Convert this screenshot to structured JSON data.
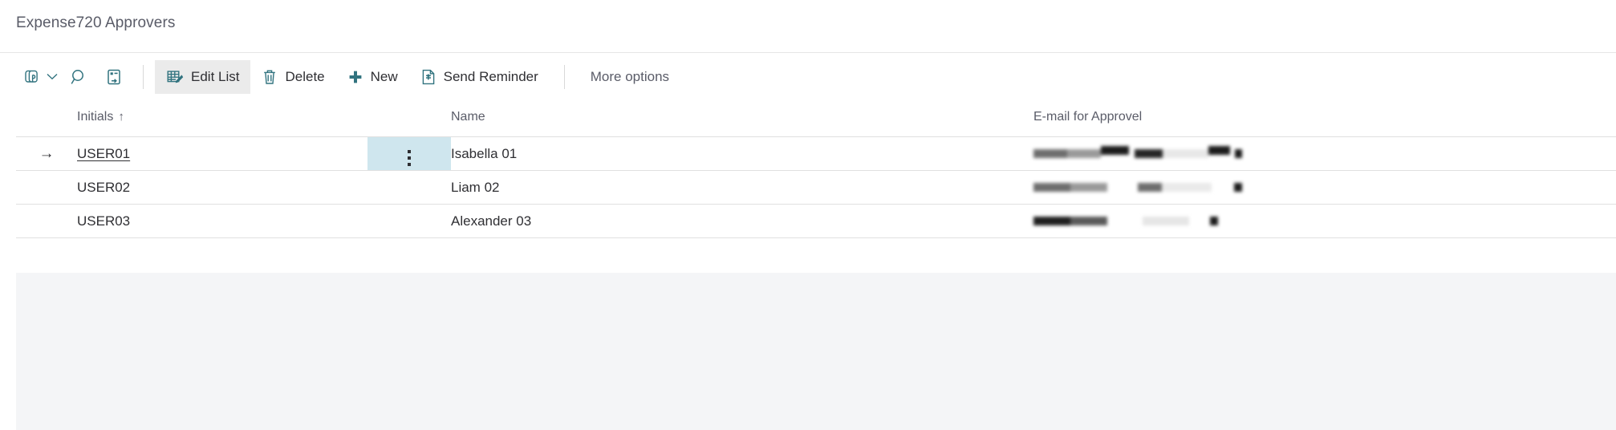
{
  "page": {
    "title": "Expense720 Approvers",
    "accent_color": "#31737f",
    "title_color": "#5a5c68",
    "selected_cell_color": "#cfe6ee",
    "active_button_bg": "#ebebeb",
    "page_background": "#f4f5f7"
  },
  "toolbar": {
    "icons": [
      {
        "name": "share-icon",
        "glyph": "share"
      },
      {
        "name": "chevron-down-icon",
        "glyph": "chevron-down"
      },
      {
        "name": "search-icon",
        "glyph": "magnifier"
      },
      {
        "name": "open-in-new-window-icon",
        "glyph": "window"
      }
    ],
    "commands": [
      {
        "label": "Edit List",
        "icon": "edit-list-icon",
        "active": true
      },
      {
        "label": "Delete",
        "icon": "trash-icon",
        "active": false
      },
      {
        "label": "New",
        "icon": "plus-icon",
        "active": false
      },
      {
        "label": "Send Reminder",
        "icon": "send-reminder-icon",
        "active": false
      }
    ],
    "more_options_label": "More options"
  },
  "grid": {
    "columns": [
      {
        "key": "initials",
        "label": "Initials",
        "sorted": true,
        "sort_indicator": "↑"
      },
      {
        "key": "name",
        "label": "Name",
        "sorted": false,
        "sort_indicator": ""
      },
      {
        "key": "email",
        "label": "E-mail for Approvel",
        "sorted": false,
        "sort_indicator": ""
      }
    ],
    "rows": [
      {
        "current": true,
        "row_indicator": "→",
        "initials": "USER01",
        "name": "Isabella 01",
        "email": "",
        "email_redacted": true,
        "menu_open": true
      },
      {
        "current": false,
        "row_indicator": "",
        "initials": "USER02",
        "name": "Liam 02",
        "email": "",
        "email_redacted": true,
        "menu_open": false
      },
      {
        "current": false,
        "row_indicator": "",
        "initials": "USER03",
        "name": "Alexander 03",
        "email": "",
        "email_redacted": true,
        "menu_open": false
      }
    ]
  }
}
